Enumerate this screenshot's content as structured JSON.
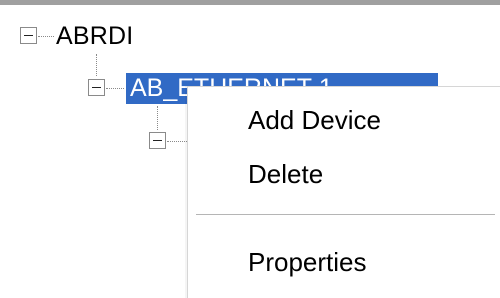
{
  "tree": {
    "root": {
      "label": "ABRDI",
      "expander_icon": "minus-box-icon"
    },
    "selected_node": {
      "label": "AB_ETHERNET-1",
      "expander_icon": "minus-box-icon"
    },
    "child_node": {
      "label": "",
      "expander_icon": "minus-box-icon"
    }
  },
  "context_menu": {
    "items": [
      {
        "label": "Add Device"
      },
      {
        "label": "Delete"
      },
      {
        "label": "Properties"
      }
    ]
  },
  "colors": {
    "selection": "#316ac5",
    "selection_text": "#ffffff",
    "tree_lines": "#8a8a8a"
  }
}
